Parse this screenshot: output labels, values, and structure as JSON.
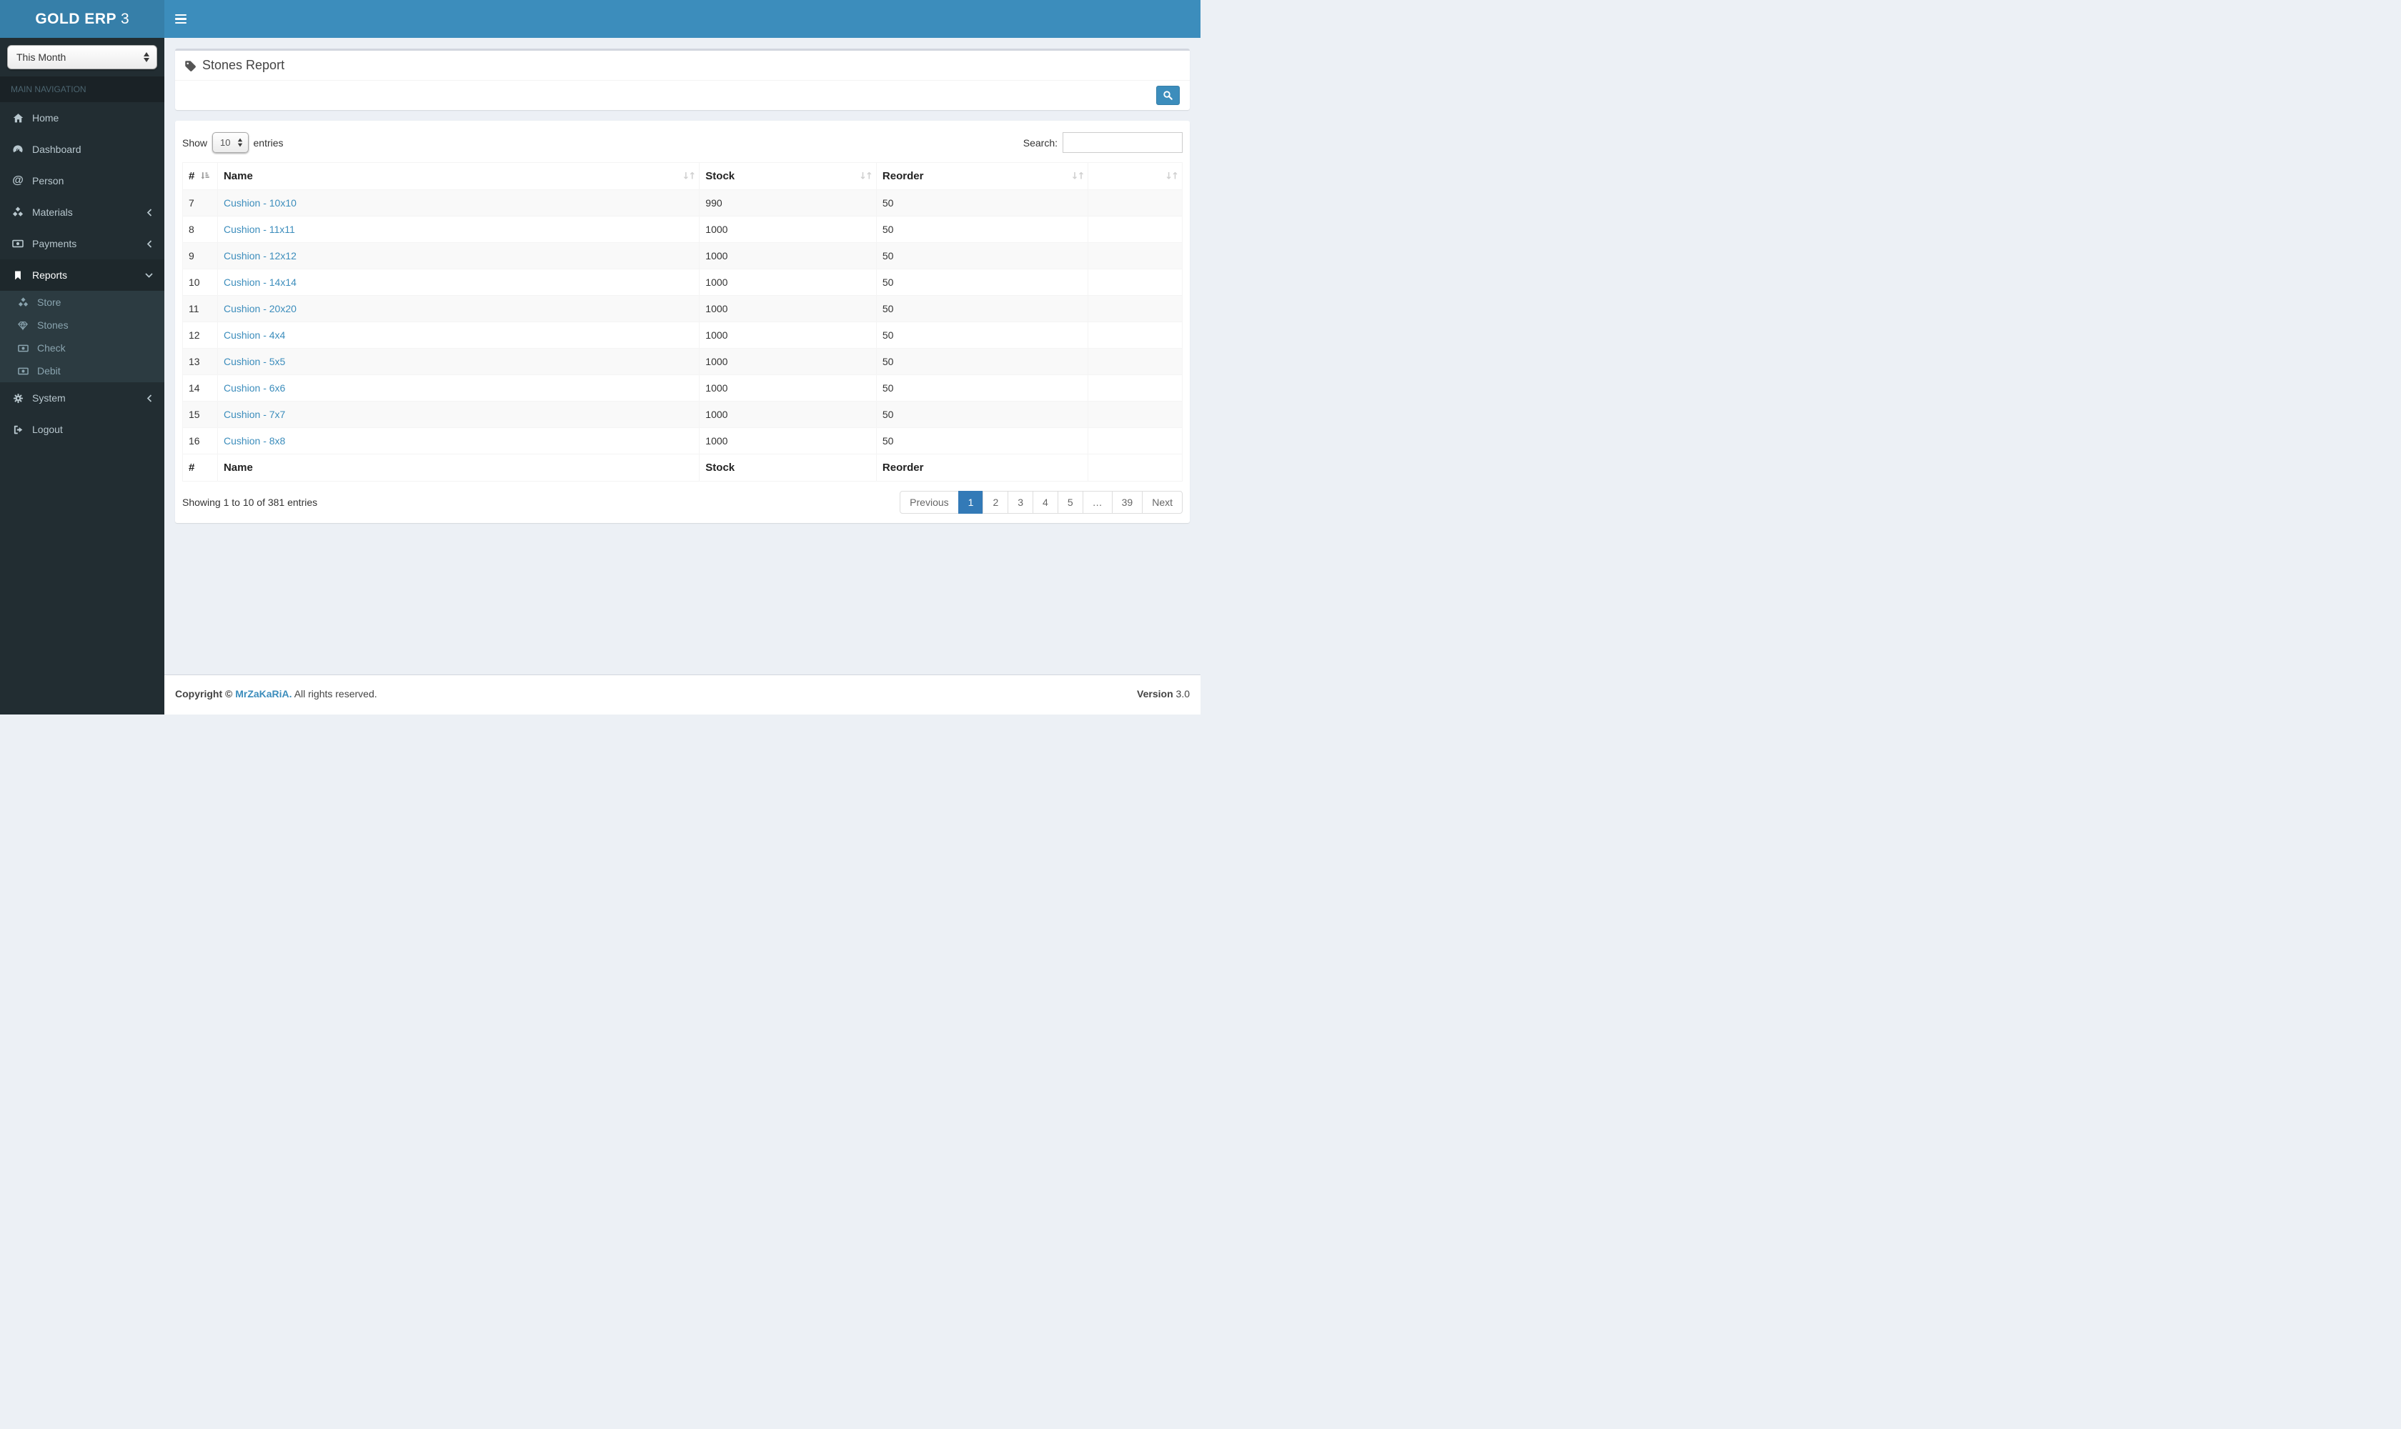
{
  "colors": {
    "navbar": "#3c8dbc",
    "logo_bg": "#367fa9",
    "sidebar_bg": "#222d32",
    "submenu_bg": "#2c3b41",
    "link_accent": "#3c8dbc",
    "pagination_active": "#337ab7",
    "content_bg": "#ecf0f5"
  },
  "topbar": {
    "logo_bold": "GOLD ERP",
    "logo_digit": "3"
  },
  "sidebar": {
    "period_select": {
      "value": "This Month"
    },
    "section_label": "MAIN NAVIGATION",
    "items": [
      {
        "label": "Home",
        "icon": "home-icon"
      },
      {
        "label": "Dashboard",
        "icon": "dashboard-icon"
      },
      {
        "label": "Person",
        "icon": "at-icon"
      },
      {
        "label": "Materials",
        "icon": "cubes-icon",
        "chevron": "left"
      },
      {
        "label": "Payments",
        "icon": "money-icon",
        "chevron": "left"
      },
      {
        "label": "Reports",
        "icon": "bookmark-icon",
        "chevron": "down",
        "active": true
      },
      {
        "label": "System",
        "icon": "gear-icon",
        "chevron": "left"
      },
      {
        "label": "Logout",
        "icon": "sign-out-icon"
      }
    ],
    "reports_submenu": [
      {
        "label": "Store",
        "icon": "cubes-icon"
      },
      {
        "label": "Stones",
        "icon": "diamond-icon"
      },
      {
        "label": "Check",
        "icon": "money-icon"
      },
      {
        "label": "Debit",
        "icon": "money-icon"
      }
    ]
  },
  "page": {
    "title": "Stones Report"
  },
  "table_card": {
    "show_label": "Show",
    "page_length": "10",
    "entries_label": "entries",
    "search_label": "Search:",
    "search_value": "",
    "columns": {
      "num": "#",
      "name": "Name",
      "stock": "Stock",
      "reorder": "Reorder",
      "extra": ""
    },
    "rows": [
      {
        "num": "7",
        "name": "Cushion - 10x10",
        "stock": "990",
        "reorder": "50"
      },
      {
        "num": "8",
        "name": "Cushion - 11x11",
        "stock": "1000",
        "reorder": "50"
      },
      {
        "num": "9",
        "name": "Cushion - 12x12",
        "stock": "1000",
        "reorder": "50"
      },
      {
        "num": "10",
        "name": "Cushion - 14x14",
        "stock": "1000",
        "reorder": "50"
      },
      {
        "num": "11",
        "name": "Cushion - 20x20",
        "stock": "1000",
        "reorder": "50"
      },
      {
        "num": "12",
        "name": "Cushion - 4x4",
        "stock": "1000",
        "reorder": "50"
      },
      {
        "num": "13",
        "name": "Cushion - 5x5",
        "stock": "1000",
        "reorder": "50"
      },
      {
        "num": "14",
        "name": "Cushion - 6x6",
        "stock": "1000",
        "reorder": "50"
      },
      {
        "num": "15",
        "name": "Cushion - 7x7",
        "stock": "1000",
        "reorder": "50"
      },
      {
        "num": "16",
        "name": "Cushion - 8x8",
        "stock": "1000",
        "reorder": "50"
      }
    ],
    "footer_columns": {
      "num": "#",
      "name": "Name",
      "stock": "Stock",
      "reorder": "Reorder",
      "extra": ""
    },
    "info": "Showing 1 to 10 of 381 entries",
    "pagination": {
      "previous": "Previous",
      "pages": [
        "1",
        "2",
        "3",
        "4",
        "5",
        "…",
        "39"
      ],
      "active_page": "1",
      "next": "Next"
    }
  },
  "footer": {
    "copyright_bold": "Copyright ©",
    "brand_link": "MrZaKaRiA.",
    "rights_text": "All rights reserved.",
    "version_label": "Version",
    "version_number": "3.0"
  }
}
